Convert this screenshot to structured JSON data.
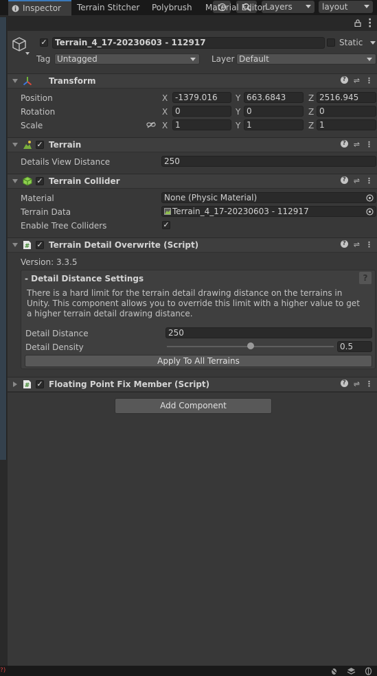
{
  "toolbar": {
    "layers_label": "Layers",
    "layout_label": "layout"
  },
  "tabs": [
    {
      "label": "Inspector"
    },
    {
      "label": "Terrain Stitcher"
    },
    {
      "label": "Polybrush"
    },
    {
      "label": "Material Editor"
    }
  ],
  "gameobject": {
    "name": "Terrain_4_17-20230603 - 112917",
    "static_label": "Static",
    "tag_label": "Tag",
    "tag_value": "Untagged",
    "layer_label": "Layer",
    "layer_value": "Default"
  },
  "transform": {
    "title": "Transform",
    "position_label": "Position",
    "rotation_label": "Rotation",
    "scale_label": "Scale",
    "axis_x": "X",
    "axis_y": "Y",
    "axis_z": "Z",
    "position": {
      "x": "-1379.016",
      "y": "663.6843",
      "z": "2516.945"
    },
    "rotation": {
      "x": "0",
      "y": "0",
      "z": "0"
    },
    "scale": {
      "x": "1",
      "y": "1",
      "z": "1"
    }
  },
  "terrain": {
    "title": "Terrain",
    "details_view_distance_label": "Details View Distance",
    "details_view_distance_value": "250"
  },
  "terrain_collider": {
    "title": "Terrain Collider",
    "material_label": "Material",
    "material_value": "None (Physic Material)",
    "terrain_data_label": "Terrain Data",
    "terrain_data_value": "Terrain_4_17-20230603 - 112917",
    "enable_tree_colliders_label": "Enable Tree Colliders",
    "enable_tree_colliders_checked": true
  },
  "detail_overwrite": {
    "title": "Terrain Detail Overwrite (Script)",
    "version": "Version: 3.3.5",
    "box_title": "- Detail Distance Settings",
    "description": "There is a hard limit for the terrain detail drawing distance on the terrains in Unity. This component allows you to override this limit with a higher value to get a higher terrain detail drawing distance.",
    "detail_distance_label": "Detail Distance",
    "detail_distance_value": "250",
    "detail_density_label": "Detail Density",
    "detail_density_value": "0.5",
    "detail_density_fraction": 0.5,
    "apply_button": "Apply To All Terrains"
  },
  "floating_point": {
    "title": "Floating Point Fix Member (Script)"
  },
  "add_component_label": "Add Component",
  "colors": {
    "accent": "#3a79bb",
    "panel_bg": "#383838",
    "header_bg": "#3e3e3e",
    "field_bg": "#2a2a2a"
  }
}
